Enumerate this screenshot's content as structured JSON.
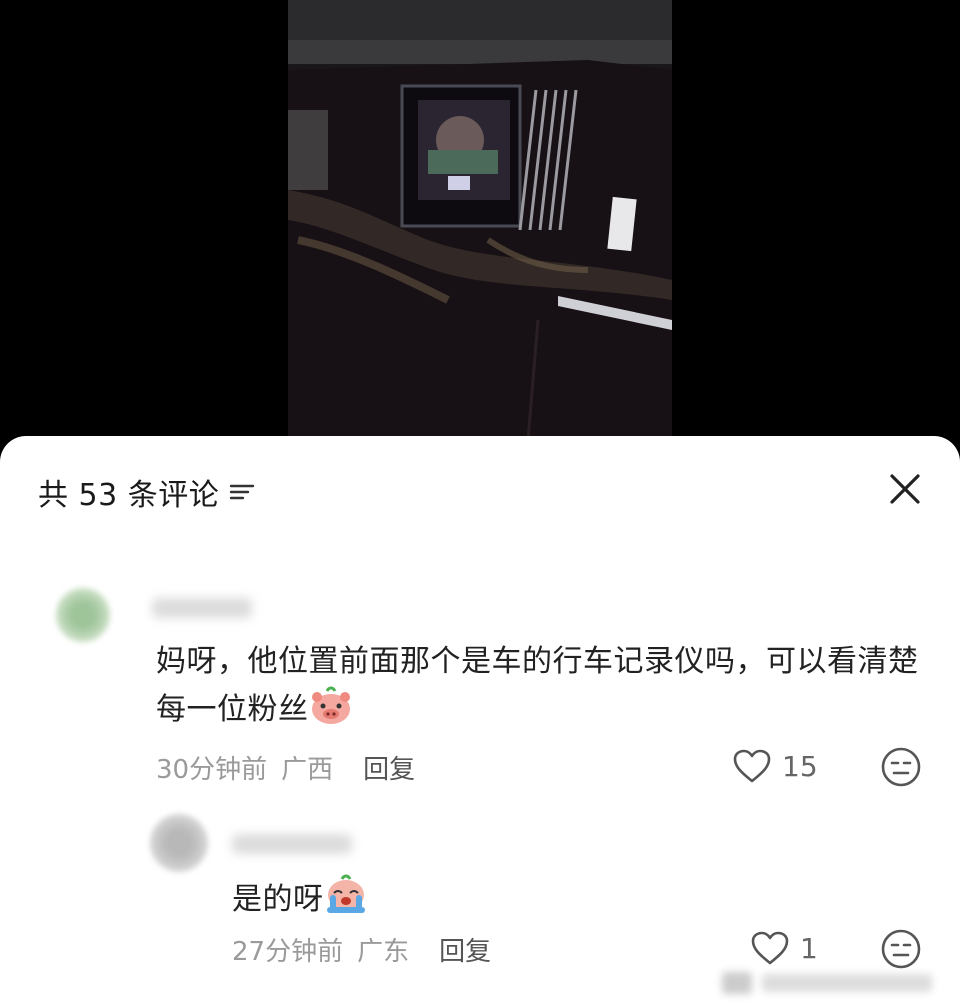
{
  "header": {
    "title": "共 53 条评论",
    "sort_icon": "filter-lines-icon",
    "close_icon": "close-icon"
  },
  "comments": [
    {
      "text": "妈呀，他位置前面那个是车的行车记录仪吗，可以看清楚每一位粉丝",
      "emoji": "pig-face-emoji",
      "time": "30分钟前",
      "location": "广西",
      "reply_label": "回复",
      "likes": "15"
    }
  ],
  "replies": [
    {
      "text": "是的呀",
      "emoji": "crying-face-emoji",
      "time": "27分钟前",
      "location": "广东",
      "reply_label": "回复",
      "likes": "1"
    }
  ],
  "colors": {
    "sheet_bg": "#ffffff",
    "text_primary": "#222222",
    "text_meta": "#9a9a9a",
    "reply_link": "#555555"
  }
}
